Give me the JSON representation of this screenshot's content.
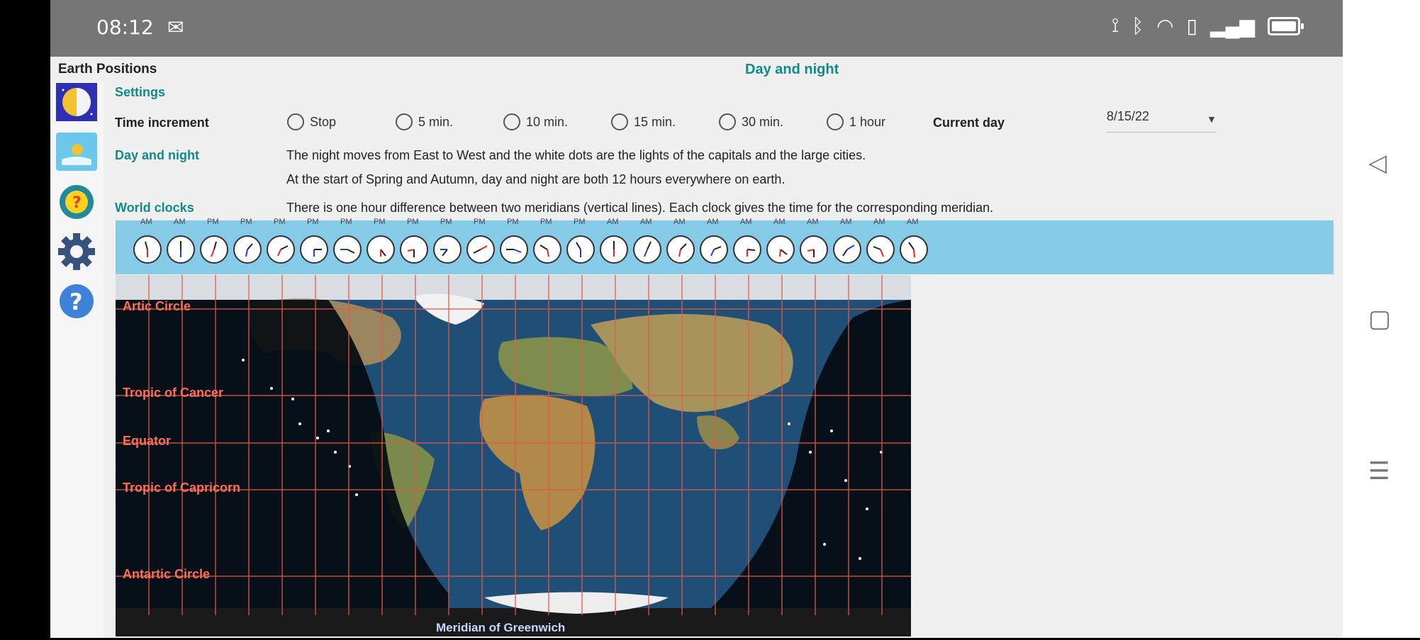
{
  "status": {
    "time": "08:12",
    "icons": [
      "mail-icon",
      "vibrate-icon",
      "bluetooth-icon",
      "wifi-icon",
      "sim-icon",
      "signal-icon",
      "battery-icon"
    ]
  },
  "app": {
    "title": "Earth Positions",
    "page_title": "Day and night",
    "sidebar_icons": [
      "day-night-icon",
      "weather-icon",
      "quiz-icon",
      "gear-icon",
      "help-icon"
    ]
  },
  "settings": {
    "label": "Settings",
    "time_increment_label": "Time increment",
    "options": [
      "Stop",
      "5 min.",
      "10 min.",
      "15 min.",
      "30 min.",
      "1 hour"
    ],
    "current_day_label": "Current day",
    "current_day_value": "8/15/22"
  },
  "day_night": {
    "label": "Day and night",
    "line1": "The night moves from East to West and the white dots are the lights of the capitals and the large cities.",
    "line2": "At the start of Spring and Autumn, day and night are both 12 hours everywhere on earth."
  },
  "world_clocks": {
    "label": "World clocks",
    "description": "There is one hour difference between two meridians (vertical lines). Each clock gives the time for the corresponding meridian.",
    "ampm": [
      "AM",
      "AM",
      "PM",
      "PM",
      "PM",
      "PM",
      "PM",
      "PM",
      "PM",
      "PM",
      "PM",
      "PM",
      "PM",
      "PM",
      "AM",
      "AM",
      "AM",
      "AM",
      "AM",
      "AM",
      "AM",
      "AM",
      "AM",
      "AM"
    ]
  },
  "map": {
    "labels": [
      "Artic Circle",
      "Tropic of Cancer",
      "Equator",
      "Tropic of Capricorn",
      "Antartic Circle"
    ],
    "meridian_label": "Meridian of Greenwich"
  },
  "navbar": {
    "icons": [
      "back-icon",
      "home-square-icon",
      "menu-icon"
    ]
  }
}
